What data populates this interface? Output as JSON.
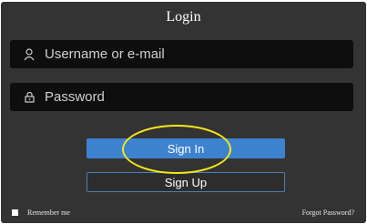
{
  "form": {
    "title": "Login",
    "username_placeholder": "Username or e-mail",
    "password_placeholder": "Password",
    "signin_label": "Sign In",
    "signup_label": "Sign Up",
    "remember_label": "Remember me",
    "forgot_label": "Forgot Password?"
  },
  "icons": {
    "username": "user-icon",
    "password": "lock-icon"
  },
  "colors": {
    "panel": "#333333",
    "field": "#0e0e0e",
    "primary": "#3d82cf",
    "highlight": "#f5e61c"
  }
}
